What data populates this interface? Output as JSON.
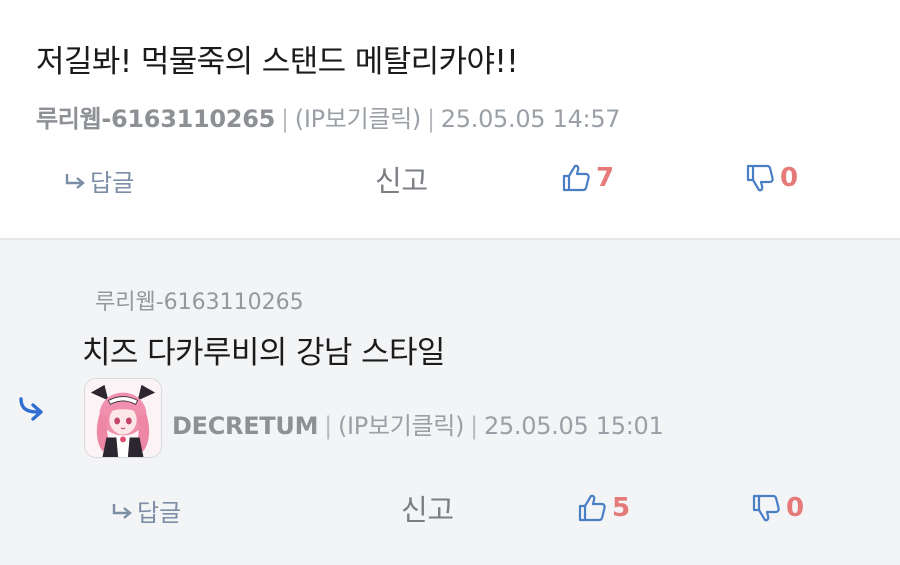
{
  "comments": [
    {
      "text": "저길봐! 먹물죽의 스탠드 메탈리카야!!",
      "author": "루리웹-6163110265",
      "ip": "(IP보기클릭)",
      "timestamp": "25.05.05 14:57",
      "reply_label": "답글",
      "report_label": "신고",
      "upvotes": "7",
      "downvotes": "0"
    }
  ],
  "reply": {
    "reply_to": "루리웹-6163110265",
    "text": "치즈 다카루비의 강남 스타일",
    "author": "DECRETUM",
    "ip": "(IP보기클릭)",
    "timestamp": "25.05.05 15:01",
    "reply_label": "답글",
    "report_label": "신고",
    "upvotes": "5",
    "downvotes": "0"
  },
  "colors": {
    "vote_count": "#e57a78",
    "thumb_icon": "#4a7fc6",
    "reply_indicator": "#2f6fcf",
    "reply_bg": "#f3f4f6"
  },
  "icons": {
    "reply_arrow": "reply-arrow-icon",
    "thumbs_up": "thumbs-up-icon",
    "thumbs_down": "thumbs-down-icon",
    "reply_indicator": "reply-indicator-icon"
  }
}
